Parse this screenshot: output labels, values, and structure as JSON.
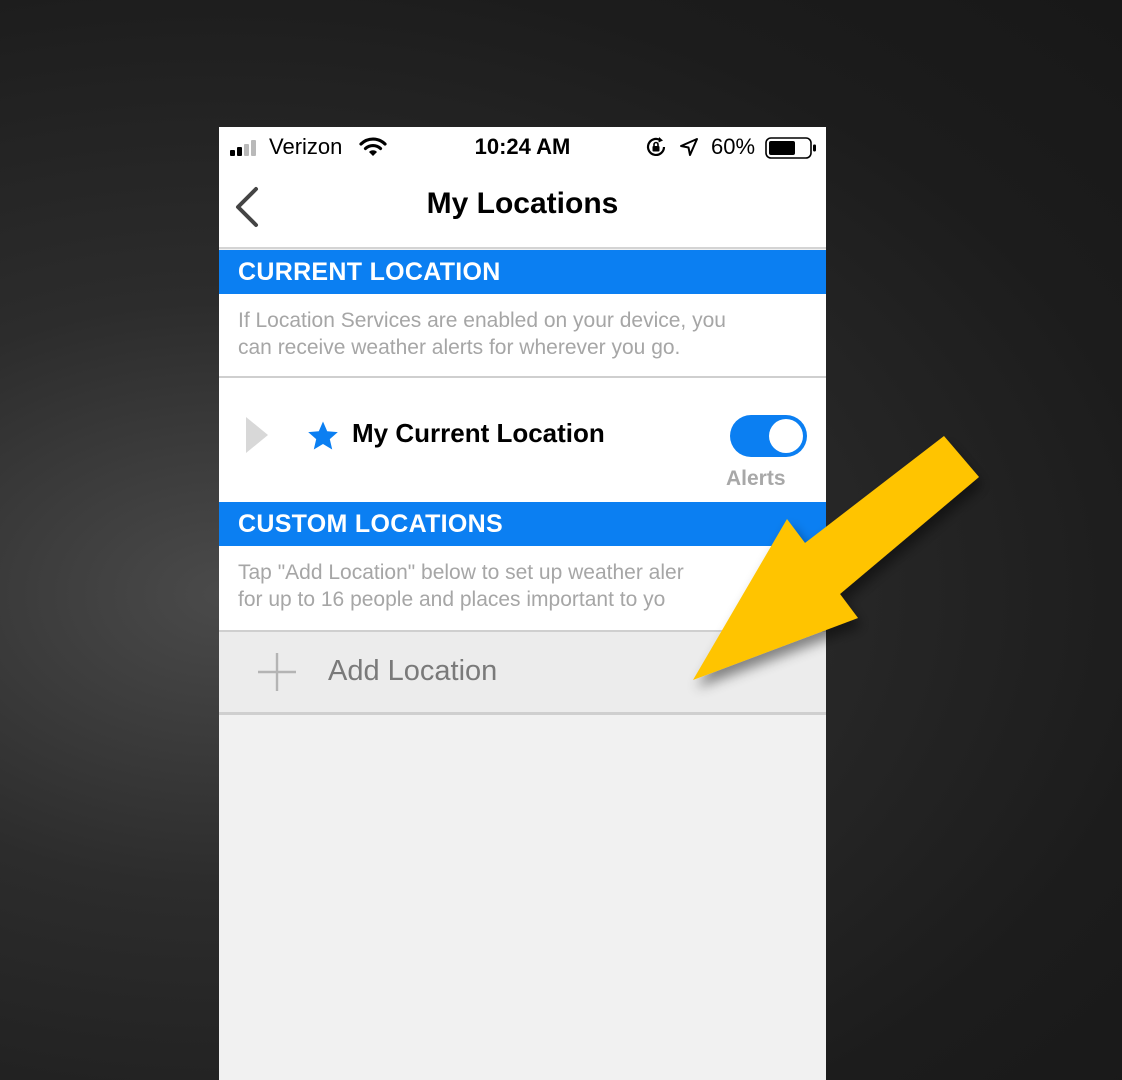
{
  "status_bar": {
    "carrier": "Verizon",
    "time": "10:24 AM",
    "battery": "60%"
  },
  "nav": {
    "title": "My Locations"
  },
  "current_section": {
    "header": "CURRENT LOCATION",
    "hint_line1": "If Location Services are enabled on your device, you",
    "hint_line2": "can receive weather alerts for wherever you go.",
    "row_label": "My Current Location",
    "alerts_label": "Alerts",
    "alerts_enabled": true
  },
  "custom_section": {
    "header": "CUSTOM LOCATIONS",
    "hint_line1": "Tap \"Add Location\" below to set up weather aler",
    "hint_line2": "for up to 16 people and places important to yo",
    "add_label": "Add Location"
  },
  "colors": {
    "accent": "#0b7ff2",
    "annotation_arrow": "#ffc400"
  }
}
